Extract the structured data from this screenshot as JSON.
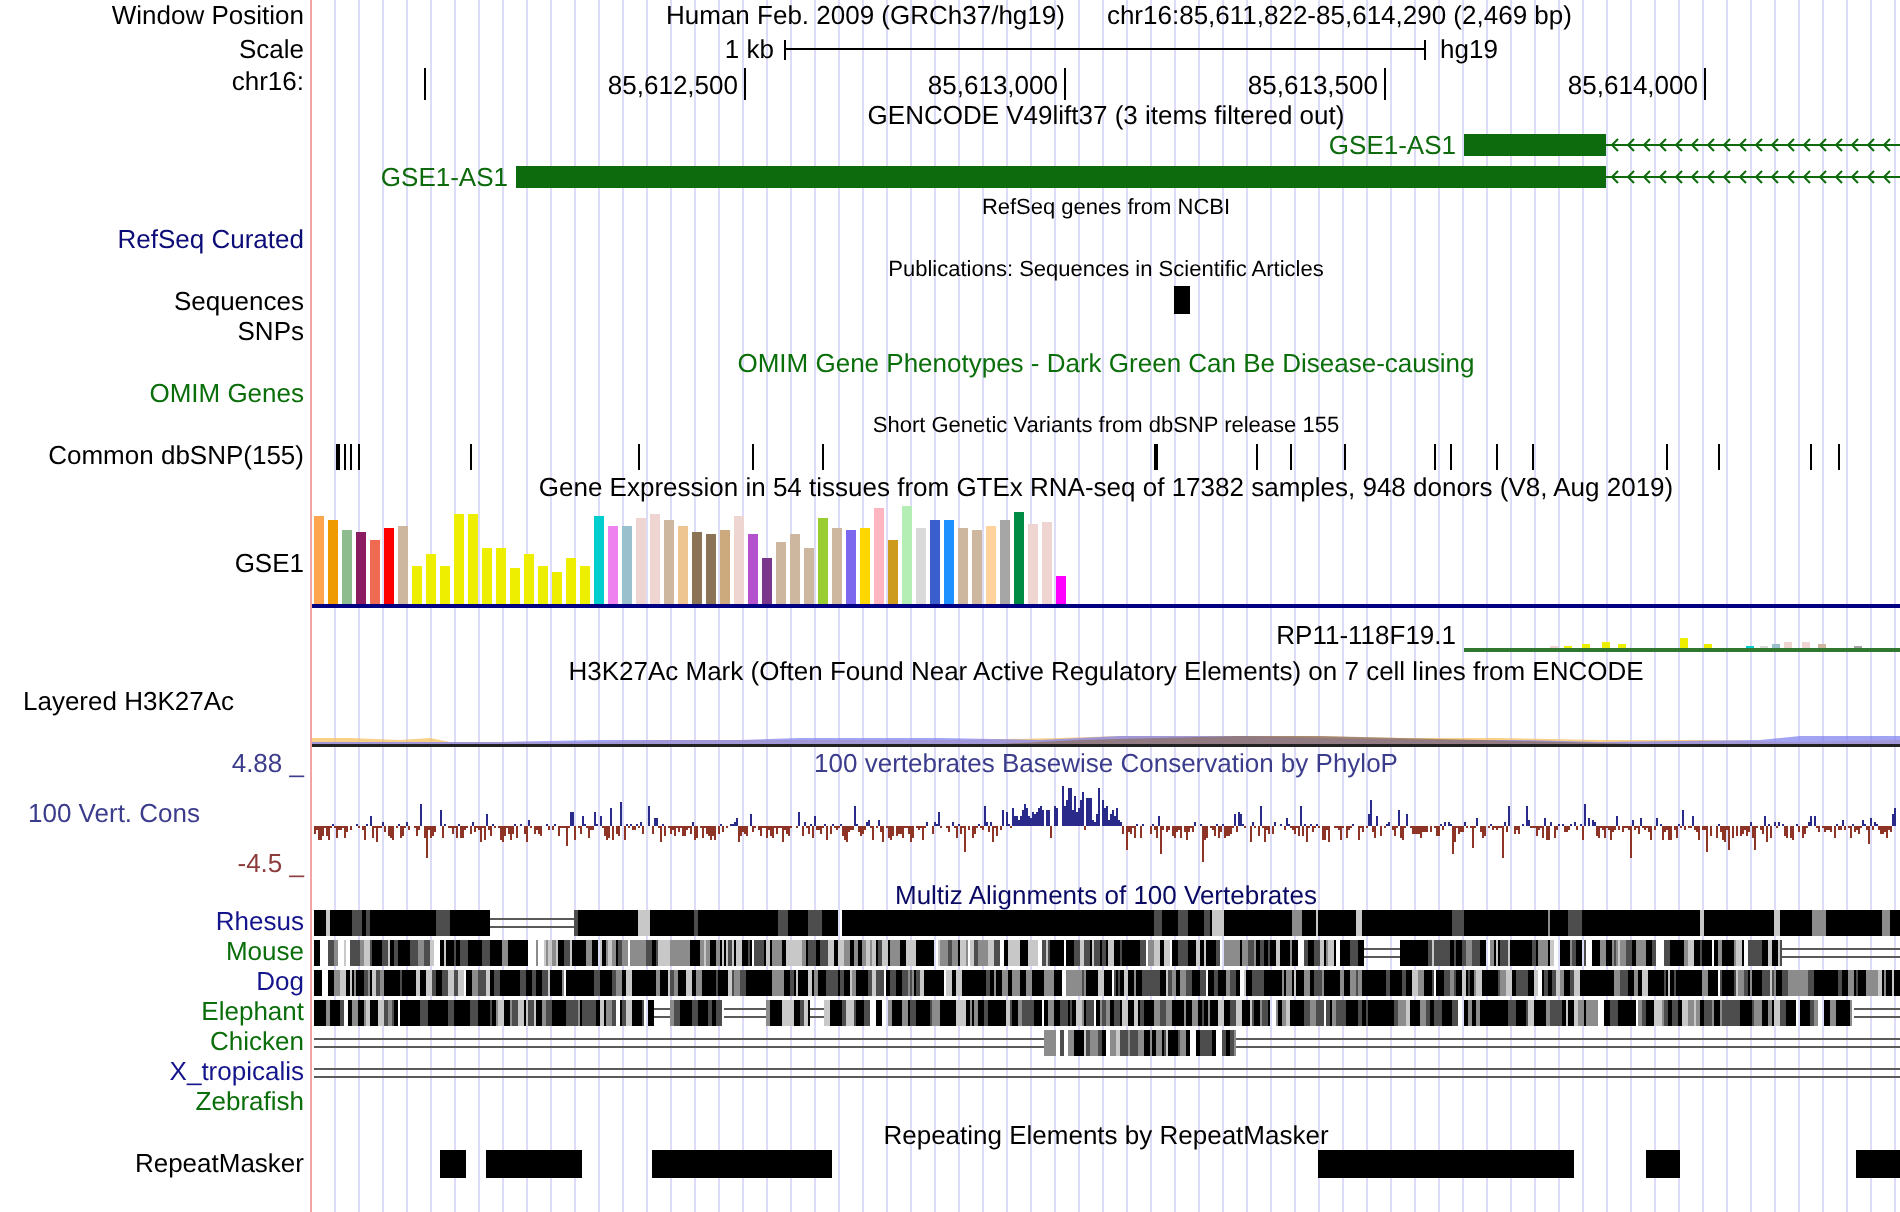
{
  "ruler": {
    "labels": [
      "Window Position",
      "Scale",
      "chr16:"
    ],
    "assembly": "Human Feb. 2009 (GRCh37/hg19)",
    "position": "chr16:85,611,822-85,614,290 (2,469 bp)",
    "scale_length": "1 kb",
    "scale_assembly": "hg19",
    "ticks": [
      "85,612,500",
      "85,613,000",
      "85,613,500",
      "85,614,000"
    ]
  },
  "tracks": [
    {
      "kind": "genes",
      "title": "GENCODE V49lift37 (3 items filtered out)",
      "color": "#000000",
      "genes": [
        {
          "name": "GSE1-AS1"
        },
        {
          "name": "GSE1-AS1"
        }
      ]
    },
    {
      "kind": "refseq",
      "title": "RefSeq genes from NCBI",
      "color": "#000000",
      "labels": [
        {
          "text": "RefSeq Curated",
          "color": "#0c0c78"
        }
      ]
    },
    {
      "kind": "publications",
      "title": "Publications: Sequences in Scientific Articles",
      "color": "#000000",
      "labels": [
        {
          "text": "Sequences",
          "color": "#000000"
        },
        {
          "text": "SNPs",
          "color": "#000000"
        }
      ]
    },
    {
      "kind": "omim",
      "title": "OMIM Gene Phenotypes - Dark Green Can Be Disease-causing",
      "color": "#0a6e0a",
      "labels": [
        {
          "text": "OMIM Genes",
          "color": "#0a6e0a"
        }
      ]
    },
    {
      "kind": "snps",
      "title": "Short Genetic Variants from dbSNP release 155",
      "color": "#000000",
      "labels": [
        {
          "text": "Common dbSNP(155)",
          "color": "#000000"
        }
      ]
    },
    {
      "kind": "expression",
      "title": "Gene Expression in 54 tissues from GTEx RNA-seq of 17382 samples, 948 donors (V8, Aug 2019)",
      "color": "#000000",
      "labels": [
        {
          "text": "GSE1",
          "color": "#000000"
        }
      ],
      "genes": [
        {
          "name": "RP11-118F19.1"
        }
      ]
    },
    {
      "kind": "signal",
      "title": "H3K27Ac Mark (Often Found Near Active Regulatory Elements) on 7 cell lines from ENCODE",
      "color": "#000000",
      "labels": [
        {
          "text": "Layered H3K27Ac",
          "color": "#000000"
        }
      ]
    },
    {
      "kind": "conservation",
      "title": "100 vertebrates Basewise Conservation by PhyloP",
      "color": "#3c3c8c",
      "labels": [
        {
          "kind": "axis",
          "text": "4.88 _",
          "color": "#3c3c8c"
        },
        {
          "kind": "name",
          "text": "100 Vert. Cons",
          "color": "#3c3c8c"
        },
        {
          "kind": "axis",
          "text": "-4.5 _",
          "color": "#8c3c3c"
        }
      ]
    },
    {
      "kind": "alignment",
      "title": "Multiz Alignments of 100 Vertebrates",
      "color": "#0a0a64",
      "labels": [
        {
          "text": "Rhesus",
          "color": "#14148c"
        },
        {
          "text": "Mouse",
          "color": "#0a6e0a"
        },
        {
          "text": "Dog",
          "color": "#14148c"
        },
        {
          "text": "Elephant",
          "color": "#0a6e0a"
        },
        {
          "text": "Chicken",
          "color": "#0a6e0a"
        },
        {
          "text": "X_tropicalis",
          "color": "#14148c"
        },
        {
          "text": "Zebrafish",
          "color": "#0a6e0a"
        }
      ]
    },
    {
      "kind": "repeats",
      "title": "Repeating Elements by RepeatMasker",
      "color": "#000000",
      "labels": [
        {
          "text": "RepeatMasker",
          "color": "#000000"
        }
      ]
    }
  ]
}
